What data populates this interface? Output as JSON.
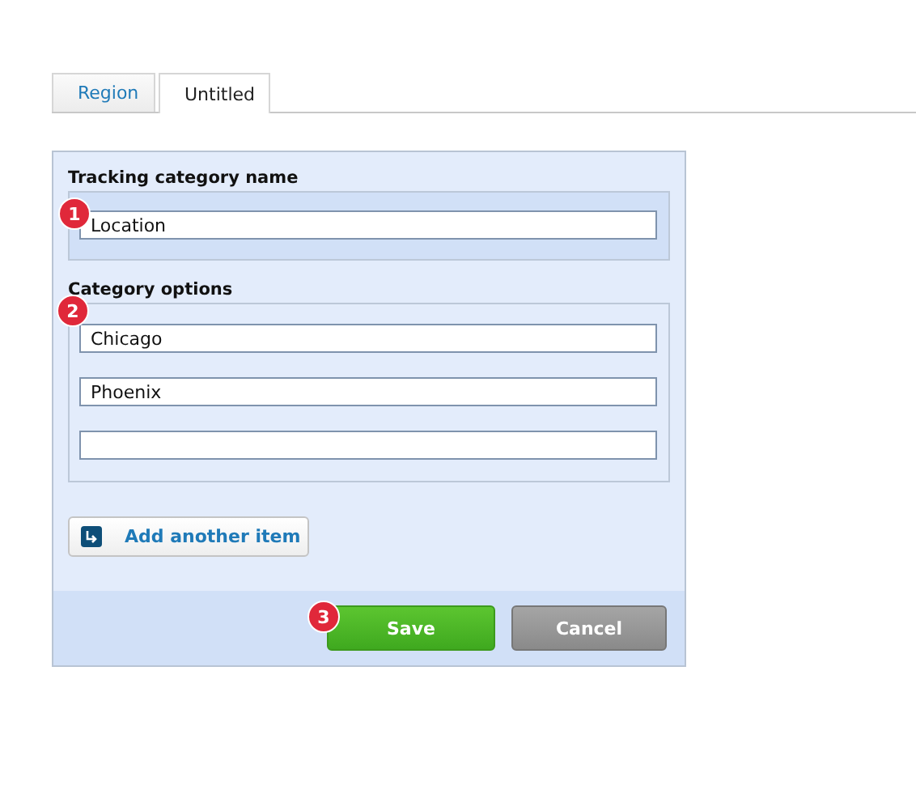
{
  "tabs": [
    {
      "label": "Region",
      "selected": false
    },
    {
      "label": "Untitled",
      "selected": true
    }
  ],
  "name_section": {
    "label": "Tracking category name",
    "marker": "1",
    "value": "Location"
  },
  "options_section": {
    "label": "Category options",
    "marker": "2",
    "options": [
      {
        "kind": "filled",
        "value": "Chicago"
      },
      {
        "kind": "filled",
        "value": "Phoenix"
      },
      {
        "kind": "empty"
      }
    ]
  },
  "add_button": {
    "label": "Add another item"
  },
  "footer": {
    "marker": "3",
    "save": "Save",
    "cancel": "Cancel"
  }
}
